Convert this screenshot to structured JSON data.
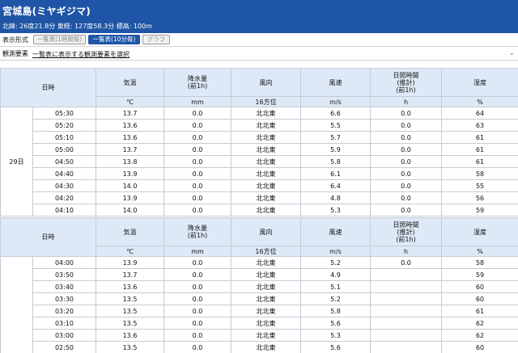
{
  "station": {
    "title": "宮城島(ミヤギジマ)",
    "coords": "北緯: 26度21.8分 東経: 127度58.3分 標高: 100m"
  },
  "display": {
    "label": "表示形式",
    "buttons": [
      "一覧表(1時間毎)",
      "一覧表(10分毎)",
      "グラフ"
    ],
    "active": "一覧表(10分毎)"
  },
  "elements": {
    "label": "観測要素",
    "select_text": "一覧表に表示する観測要素を選択"
  },
  "table": {
    "headers": [
      "日時",
      "気温",
      "降水量\n(前1h)",
      "風向",
      "風速",
      "日照時間\n(推計)\n(前1h)",
      "湿度"
    ],
    "units": [
      "℃",
      "mm",
      "16方位",
      "m/s",
      "h",
      "%"
    ],
    "date": "29日",
    "block1": [
      [
        "05:30",
        "13.7",
        "0.0",
        "北北東",
        "6.6",
        "0.0",
        "64"
      ],
      [
        "05:20",
        "13.6",
        "0.0",
        "北北東",
        "5.5",
        "0.0",
        "63"
      ],
      [
        "05:10",
        "13.6",
        "0.0",
        "北北東",
        "5.7",
        "0.0",
        "61"
      ],
      [
        "05:00",
        "13.7",
        "0.0",
        "北北東",
        "5.9",
        "0.0",
        "61"
      ],
      [
        "04:50",
        "13.8",
        "0.0",
        "北北東",
        "5.8",
        "0.0",
        "61"
      ],
      [
        "04:40",
        "13.9",
        "0.0",
        "北北東",
        "6.1",
        "0.0",
        "58"
      ],
      [
        "04:30",
        "14.0",
        "0.0",
        "北北東",
        "6.4",
        "0.0",
        "55"
      ],
      [
        "04:20",
        "13.9",
        "0.0",
        "北北東",
        "4.8",
        "0.0",
        "56"
      ],
      [
        "04:10",
        "14.0",
        "0.0",
        "北北東",
        "5.3",
        "0.0",
        "59"
      ]
    ],
    "block2": [
      [
        "04:00",
        "13.9",
        "0.0",
        "北北東",
        "5.2",
        "0.0",
        "58"
      ],
      [
        "03:50",
        "13.7",
        "0.0",
        "北北東",
        "4.9",
        "",
        "59"
      ],
      [
        "03:40",
        "13.6",
        "0.0",
        "北北東",
        "5.1",
        "",
        "60"
      ],
      [
        "03:30",
        "13.5",
        "0.0",
        "北北東",
        "5.2",
        "",
        "60"
      ],
      [
        "03:20",
        "13.5",
        "0.0",
        "北北東",
        "5.8",
        "",
        "61"
      ],
      [
        "03:10",
        "13.5",
        "0.0",
        "北北東",
        "5.6",
        "",
        "62"
      ],
      [
        "03:00",
        "13.6",
        "0.0",
        "北北東",
        "5.3",
        "",
        "62"
      ],
      [
        "02:50",
        "13.5",
        "0.0",
        "北北東",
        "5.6",
        "",
        "60"
      ]
    ]
  },
  "colors": {
    "header_bg": "#1f55a6",
    "table_header_bg": "#dde9f6",
    "border": "#c5ccd6"
  }
}
